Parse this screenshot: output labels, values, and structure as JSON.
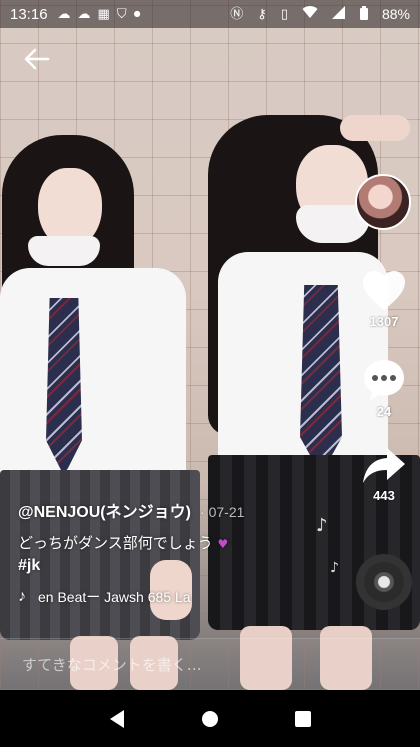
{
  "status_bar": {
    "time": "13:16",
    "battery": "88%",
    "left_icons": [
      "cloud-icon",
      "cloud-icon",
      "calendar-icon",
      "shield-check-icon",
      "dot-icon"
    ],
    "right_icons": [
      "nfc-icon",
      "key-icon",
      "vibrate-icon",
      "wifi-icon",
      "signal-icon",
      "battery-icon"
    ]
  },
  "post": {
    "username": "@NENJOU(ネンジョウ)",
    "date": "· 07-21",
    "description": "どっちがダンス部何でしょう",
    "emoji": "♥",
    "hashtag": "#jk",
    "music": "en Beatー Jawsh 685  La"
  },
  "actions": {
    "likes": "1307",
    "comments": "24",
    "shares": "443"
  },
  "comment_input": {
    "placeholder": "すてきなコメントを書く…"
  },
  "colors": {
    "accent_heart": "#c04cc8",
    "icon": "#ffffff"
  }
}
